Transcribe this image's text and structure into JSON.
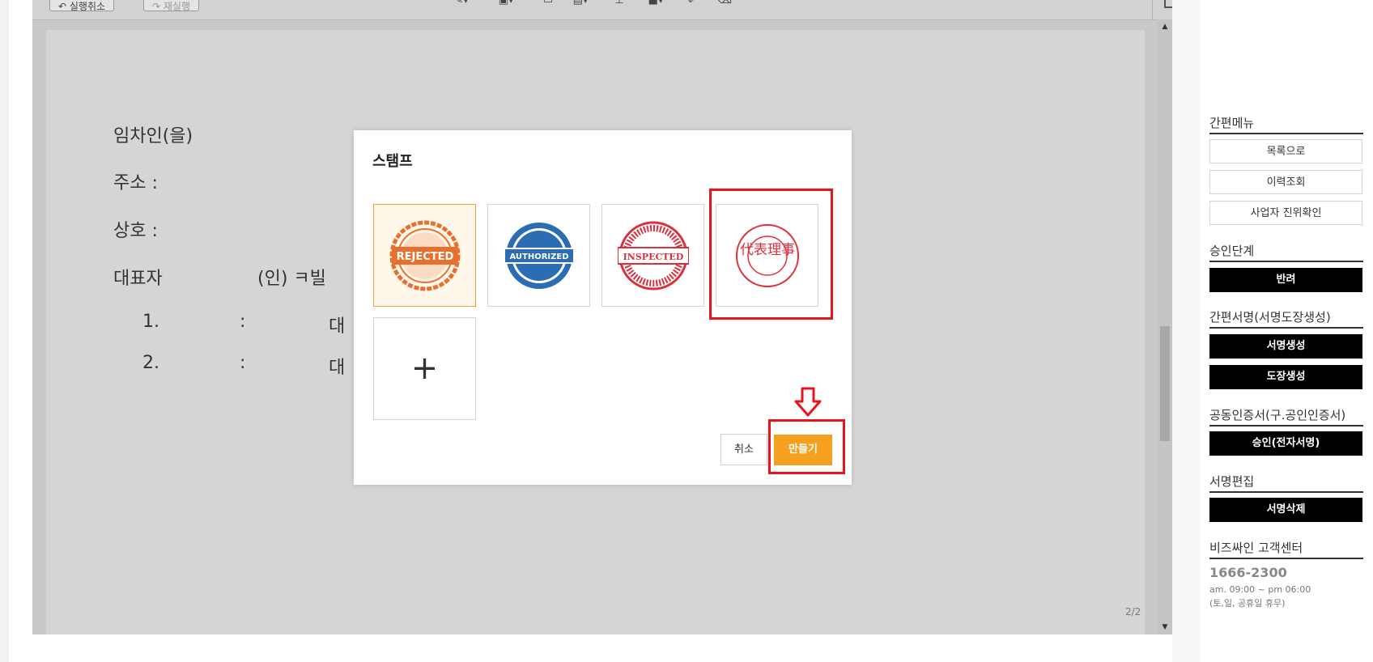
{
  "toolbar": {
    "undo_label": "실행취소",
    "redo_label": "재실행"
  },
  "document": {
    "lines": [
      "임차인(을)",
      "주소 :",
      "상호 :",
      "대표자"
    ],
    "signature_text": "(인) ㅋ빌",
    "item1_num": "1.",
    "item1_colon": ":",
    "item1_text": "대",
    "item2_num": "2.",
    "item2_colon": ":",
    "item2_text": "대",
    "page_indicator": "2/2"
  },
  "modal": {
    "title": "스탬프",
    "stamps": [
      {
        "name": "rejected",
        "text": "REJECTED",
        "color": "#e8702f"
      },
      {
        "name": "authorized",
        "text": "AUTHORIZED",
        "color": "#2b6cb3"
      },
      {
        "name": "inspected",
        "text": "INSPECTED",
        "color": "#d9303d"
      },
      {
        "name": "hanja-seal",
        "text": "代表理事",
        "color": "#e0303b"
      }
    ],
    "add_icon": "+",
    "cancel_label": "취소",
    "create_label": "만들기"
  },
  "highlight_color": "#e8141c",
  "accent_color": "#f5a01f",
  "sidebar": {
    "quick_menu": {
      "heading": "간편메뉴",
      "buttons": [
        "목록으로",
        "이력조회",
        "사업자 진위확인"
      ]
    },
    "approval": {
      "heading": "승인단계",
      "button": "반려"
    },
    "quick_sign": {
      "heading": "간편서명(서명도장생성)",
      "buttons": [
        "서명생성",
        "도장생성"
      ]
    },
    "certificate": {
      "heading": "공동인증서(구.공인인증서)",
      "button": "승인(전자서명)"
    },
    "sign_edit": {
      "heading": "서명편집",
      "button": "서명삭제"
    },
    "support": {
      "heading": "비즈싸인 고객센터",
      "phone": "1666-2300",
      "hours": "am. 09:00 ~ pm 06:00",
      "holidays": "(토,일, 공휴일 휴무)"
    }
  }
}
